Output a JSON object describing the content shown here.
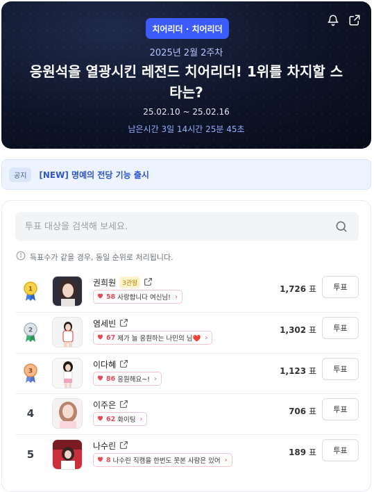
{
  "hero": {
    "badge": "치어리더 · 치어리더",
    "week": "2025년 2월 2주차",
    "title": "응원석을 열광시킨 레전드 치어리더! 1위를 차지할 스타는?",
    "period": "25.02.10 ~ 25.02.16",
    "remain": "남은시간 3일 14시간 25분 45초",
    "icons": [
      "bell-icon",
      "share-icon"
    ]
  },
  "notice": {
    "tag": "공지",
    "text": "[NEW] 명예의 전당 기능 출시"
  },
  "search": {
    "placeholder": "투표 대상을 검색해 보세요."
  },
  "info": "득표수가 같을 경우, 동일 순위로 처리됩니다.",
  "colors": {
    "accent": "#3b5bfd",
    "heart": "#e24d58",
    "gold": "#f2b600",
    "silver": "#a9b3bf",
    "bronze": "#e08a4a"
  },
  "rows": [
    {
      "rank": "1",
      "medal": "gold",
      "name": "권희원",
      "crown": "3관왕",
      "cheer_count": "58",
      "cheer_text": "사랑합니다 여신님!",
      "votes": "1,726",
      "unit": "표",
      "button": "투표"
    },
    {
      "rank": "2",
      "medal": "silver",
      "name": "염세빈",
      "crown": "",
      "cheer_count": "67",
      "cheer_text": "제가 늘 응원하는 나민의 님❤️",
      "votes": "1,302",
      "unit": "표",
      "button": "투표"
    },
    {
      "rank": "3",
      "medal": "bronze",
      "name": "이다혜",
      "crown": "",
      "cheer_count": "86",
      "cheer_text": "응원해요~!",
      "votes": "1,123",
      "unit": "표",
      "button": "투표"
    },
    {
      "rank": "4",
      "medal": "",
      "name": "이주은",
      "crown": "",
      "cheer_count": "62",
      "cheer_text": "화이팅",
      "votes": "706",
      "unit": "표",
      "button": "투표"
    },
    {
      "rank": "5",
      "medal": "",
      "name": "나수린",
      "crown": "",
      "cheer_count": "8",
      "cheer_text": "나수린 직캠을 한번도 못본 사람은 있어",
      "votes": "189",
      "unit": "표",
      "button": "투표"
    }
  ]
}
